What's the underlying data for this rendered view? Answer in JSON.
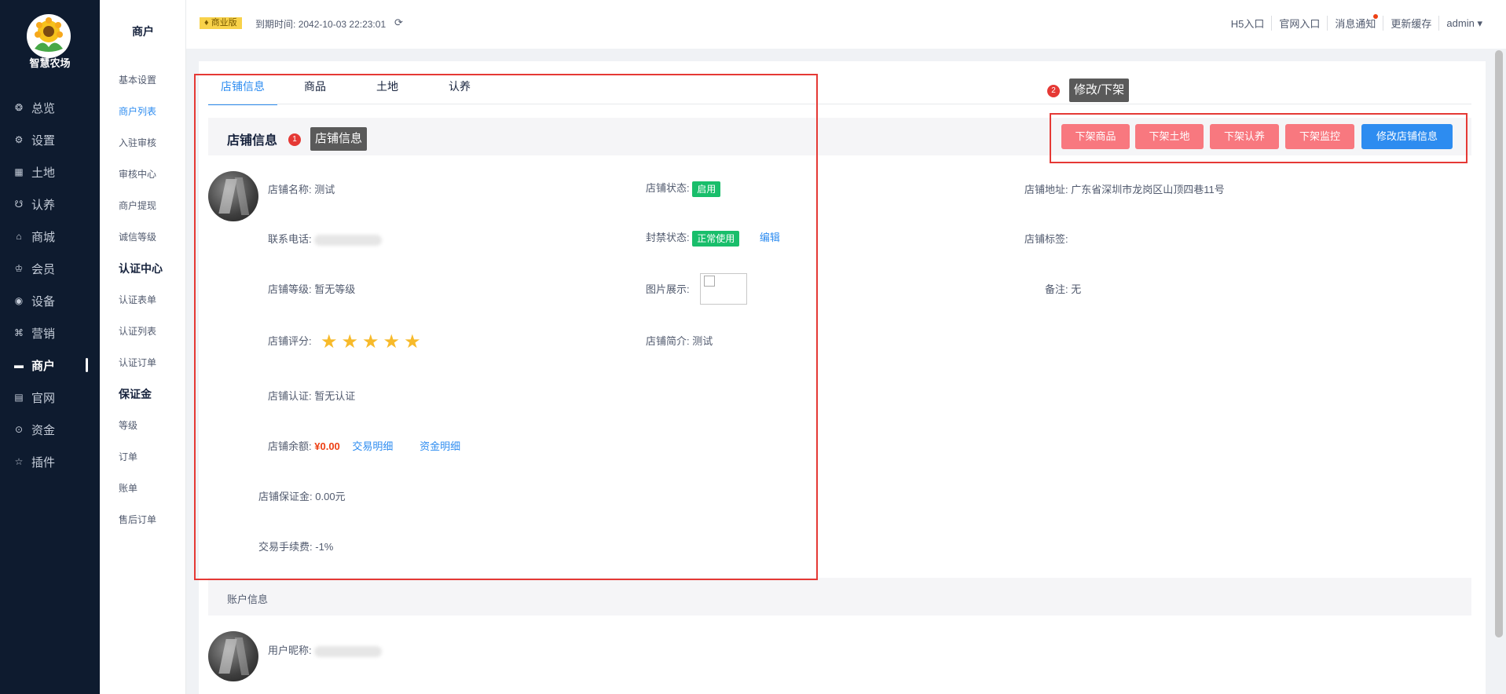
{
  "app": {
    "title": "智慧农场"
  },
  "sidebar": {
    "items": [
      {
        "label": "总览",
        "icon": "dashboard-icon",
        "glyph": "❂"
      },
      {
        "label": "设置",
        "icon": "gear-icon",
        "glyph": "⚙"
      },
      {
        "label": "土地",
        "icon": "grid-icon",
        "glyph": "▦"
      },
      {
        "label": "认养",
        "icon": "adopt-icon",
        "glyph": "☋"
      },
      {
        "label": "商城",
        "icon": "shop-icon",
        "glyph": "⌂"
      },
      {
        "label": "会员",
        "icon": "crown-icon",
        "glyph": "♔"
      },
      {
        "label": "设备",
        "icon": "location-icon",
        "glyph": "◉"
      },
      {
        "label": "营销",
        "icon": "marketing-icon",
        "glyph": "⌘"
      },
      {
        "label": "商户",
        "icon": "merchant-icon",
        "glyph": "▬"
      },
      {
        "label": "官网",
        "icon": "website-icon",
        "glyph": "▤"
      },
      {
        "label": "资金",
        "icon": "funds-icon",
        "glyph": "⊙"
      },
      {
        "label": "插件",
        "icon": "star-icon",
        "glyph": "☆"
      }
    ],
    "active_index": 8
  },
  "submenu": {
    "title": "商户",
    "items": [
      "基本设置",
      "商户列表",
      "入驻审核",
      "审核中心",
      "商户提现",
      "诚信等级"
    ],
    "group_cert": "认证中心",
    "cert_items": [
      "认证表单",
      "认证列表",
      "认证订单"
    ],
    "group_deposit": "保证金",
    "deposit_items": [
      "等级",
      "订单",
      "账单",
      "售后订单"
    ],
    "active": "商户列表"
  },
  "header": {
    "edition": "商业版",
    "expire_label": "到期时间:",
    "expire_value": "2042-10-03 22:23:01",
    "links": [
      "H5入口",
      "官网入口",
      "消息通知",
      "更新缓存",
      "admin"
    ]
  },
  "tabs": [
    "店铺信息",
    "商品",
    "土地",
    "认养"
  ],
  "store": {
    "section_title": "店铺信息",
    "name_label": "店铺名称:",
    "name_value": "测试",
    "phone_label": "联系电话:",
    "level_label": "店铺等级:",
    "level_value": "暂无等级",
    "rating_label": "店铺评分:",
    "rating_value": 5,
    "cert_label": "店铺认证:",
    "cert_value": "暂无认证",
    "balance_label": "店铺余额:",
    "balance_value": "¥0.00",
    "trade_detail": "交易明细",
    "fund_detail": "资金明细",
    "deposit_label": "店铺保证金:",
    "deposit_value": "0.00元",
    "fee_label": "交易手续费:",
    "fee_value": "-1%",
    "status_label": "店铺状态:",
    "status_value": "启用",
    "ban_label": "封禁状态:",
    "ban_value": "正常使用",
    "edit_link": "编辑",
    "images_label": "图片展示:",
    "intro_label": "店铺简介:",
    "intro_value": "测试",
    "address_label": "店铺地址:",
    "address_value": "广东省深圳市龙岗区山顶四巷11号",
    "tags_label": "店铺标签:",
    "remark_label": "备注:",
    "remark_value": "无"
  },
  "actions": [
    "下架商品",
    "下架土地",
    "下架认养",
    "下架监控",
    "修改店铺信息"
  ],
  "annotations": {
    "one_num": "1",
    "one_text": "店铺信息",
    "two_num": "2",
    "two_text": "修改/下架"
  },
  "account": {
    "section_title": "账户信息",
    "nickname_label": "用户昵称:"
  },
  "colors": {
    "sidebar_bg": "#0e1b2f",
    "primary": "#2d8cf0",
    "danger_btn": "#f8787f",
    "success": "#19be6b",
    "annotation": "#e53935"
  }
}
